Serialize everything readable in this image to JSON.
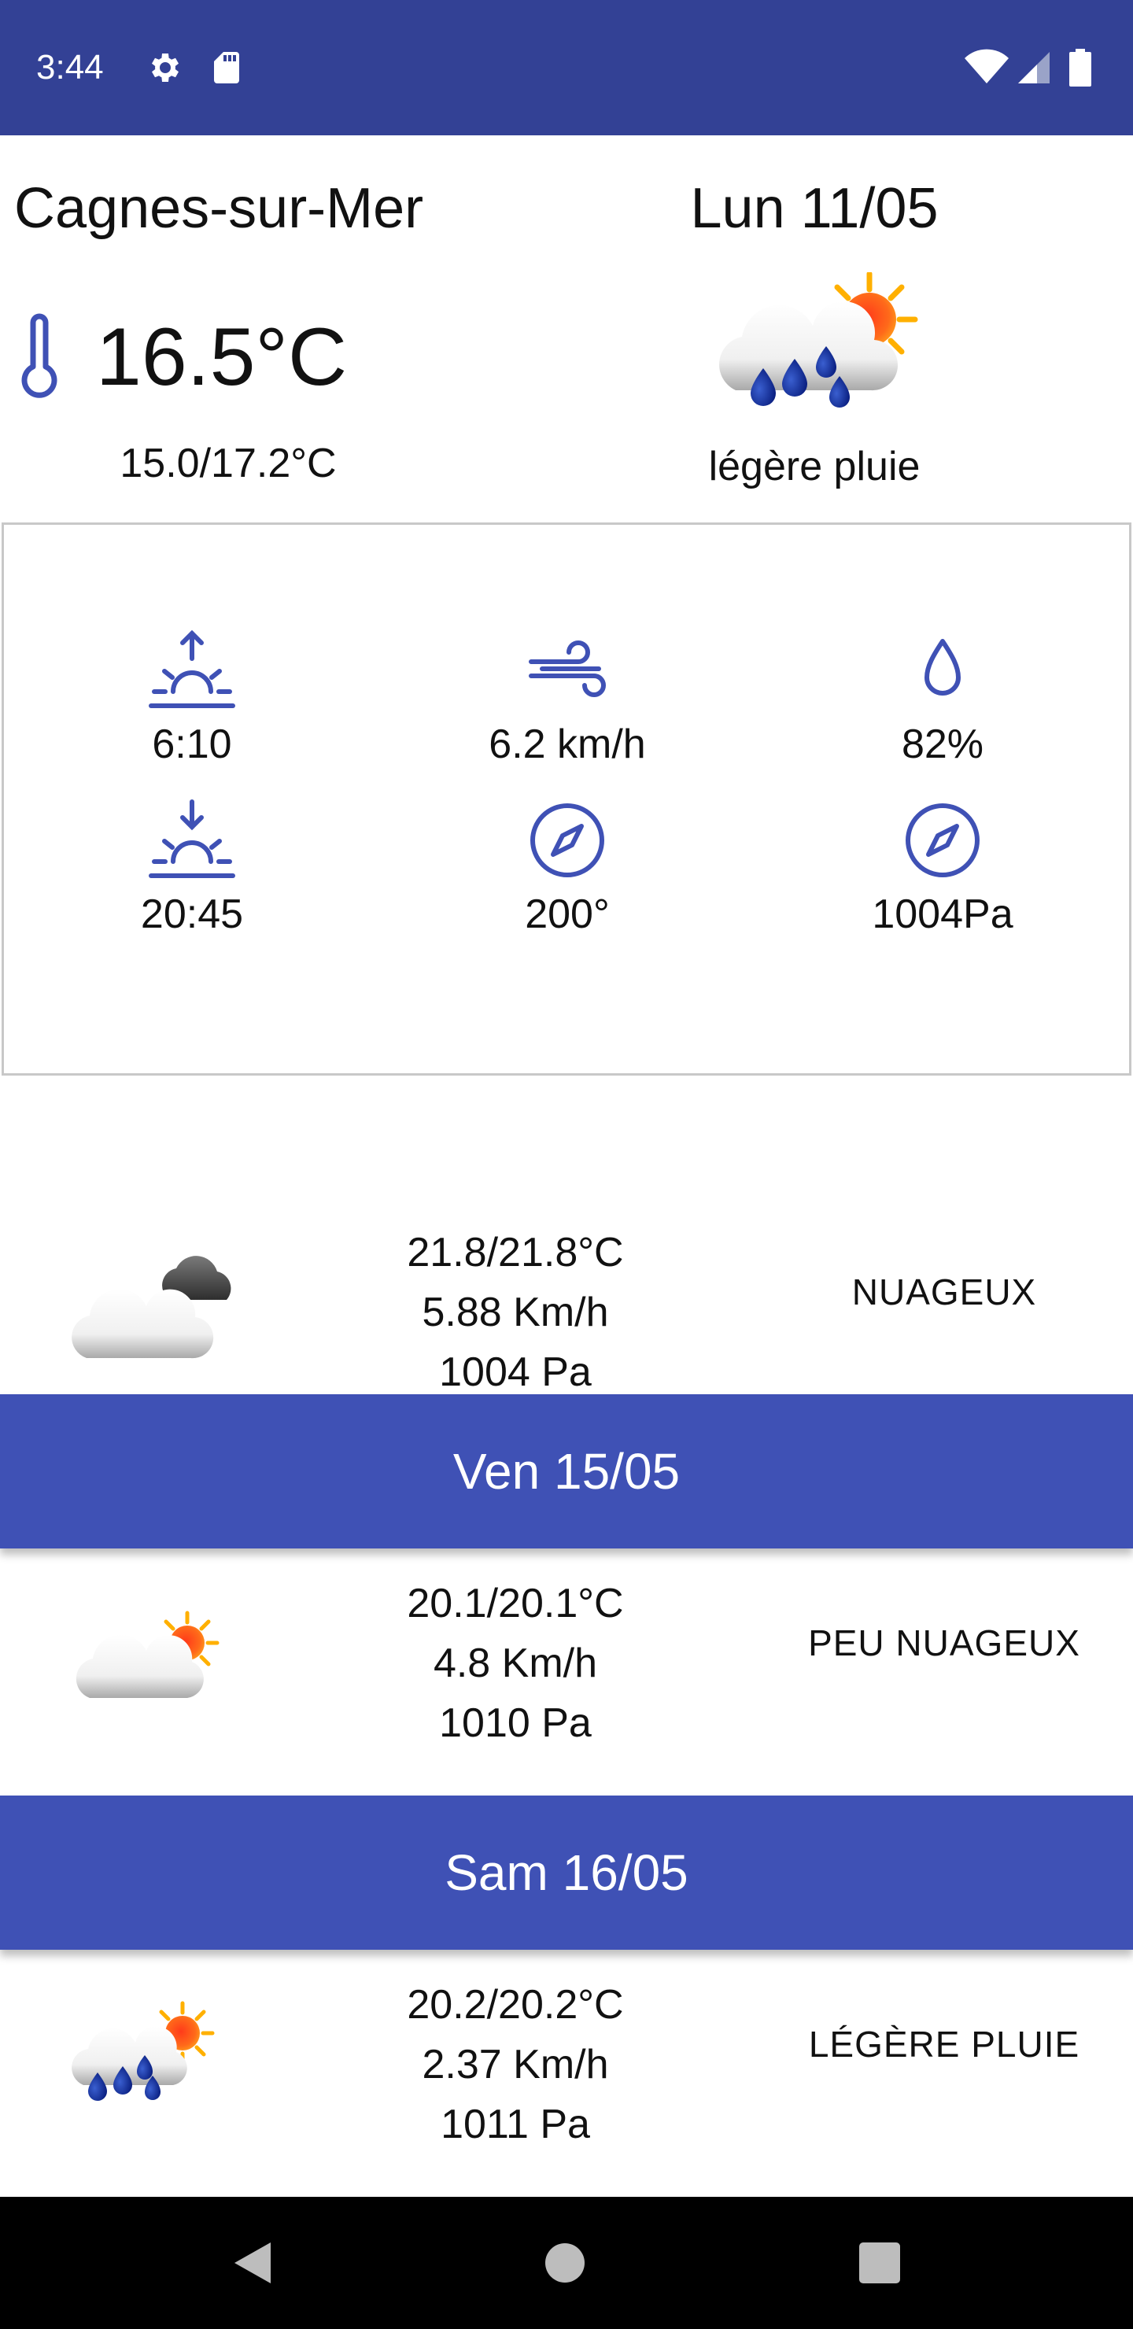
{
  "status_bar": {
    "time": "3:44",
    "icons": [
      "gear-icon",
      "sd-card-icon",
      "wifi-icon",
      "signal-icon",
      "battery-icon"
    ],
    "background": "#334195"
  },
  "current": {
    "city": "Cagnes-sur-Mer",
    "date": "Lun 11/05",
    "temperature": "16.5°C",
    "min_max": "15.0/17.2°C",
    "description": "légère pluie",
    "icon": "light-rain-sun-icon"
  },
  "details": {
    "sunrise": "6:10",
    "wind_speed": "6.2 km/h",
    "humidity": "82%",
    "sunset": "20:45",
    "wind_direction": "200°",
    "pressure": "1004Pa",
    "accent": "#3f51b5"
  },
  "forecast": [
    {
      "temp": "21.8/21.8°C",
      "wind": "5.88 Km/h",
      "pressure": "1004 Pa",
      "description": "NUAGEUX",
      "icon": "cloudy-icon"
    },
    {
      "day": "Ven 15/05",
      "temp": "20.1/20.1°C",
      "wind": "4.8 Km/h",
      "pressure": "1010 Pa",
      "description": "PEU NUAGEUX",
      "icon": "partly-cloudy-icon"
    },
    {
      "day": "Sam 16/05",
      "temp": "20.2/20.2°C",
      "wind": "2.37 Km/h",
      "pressure": "1011 Pa",
      "description": "LÉGÈRE PLUIE",
      "icon": "light-rain-sun-icon"
    }
  ],
  "colors": {
    "day_header": "#3f51b5",
    "status_bar": "#334195"
  },
  "nav_bar": {
    "buttons": [
      "back-icon",
      "home-icon",
      "recents-icon"
    ]
  }
}
